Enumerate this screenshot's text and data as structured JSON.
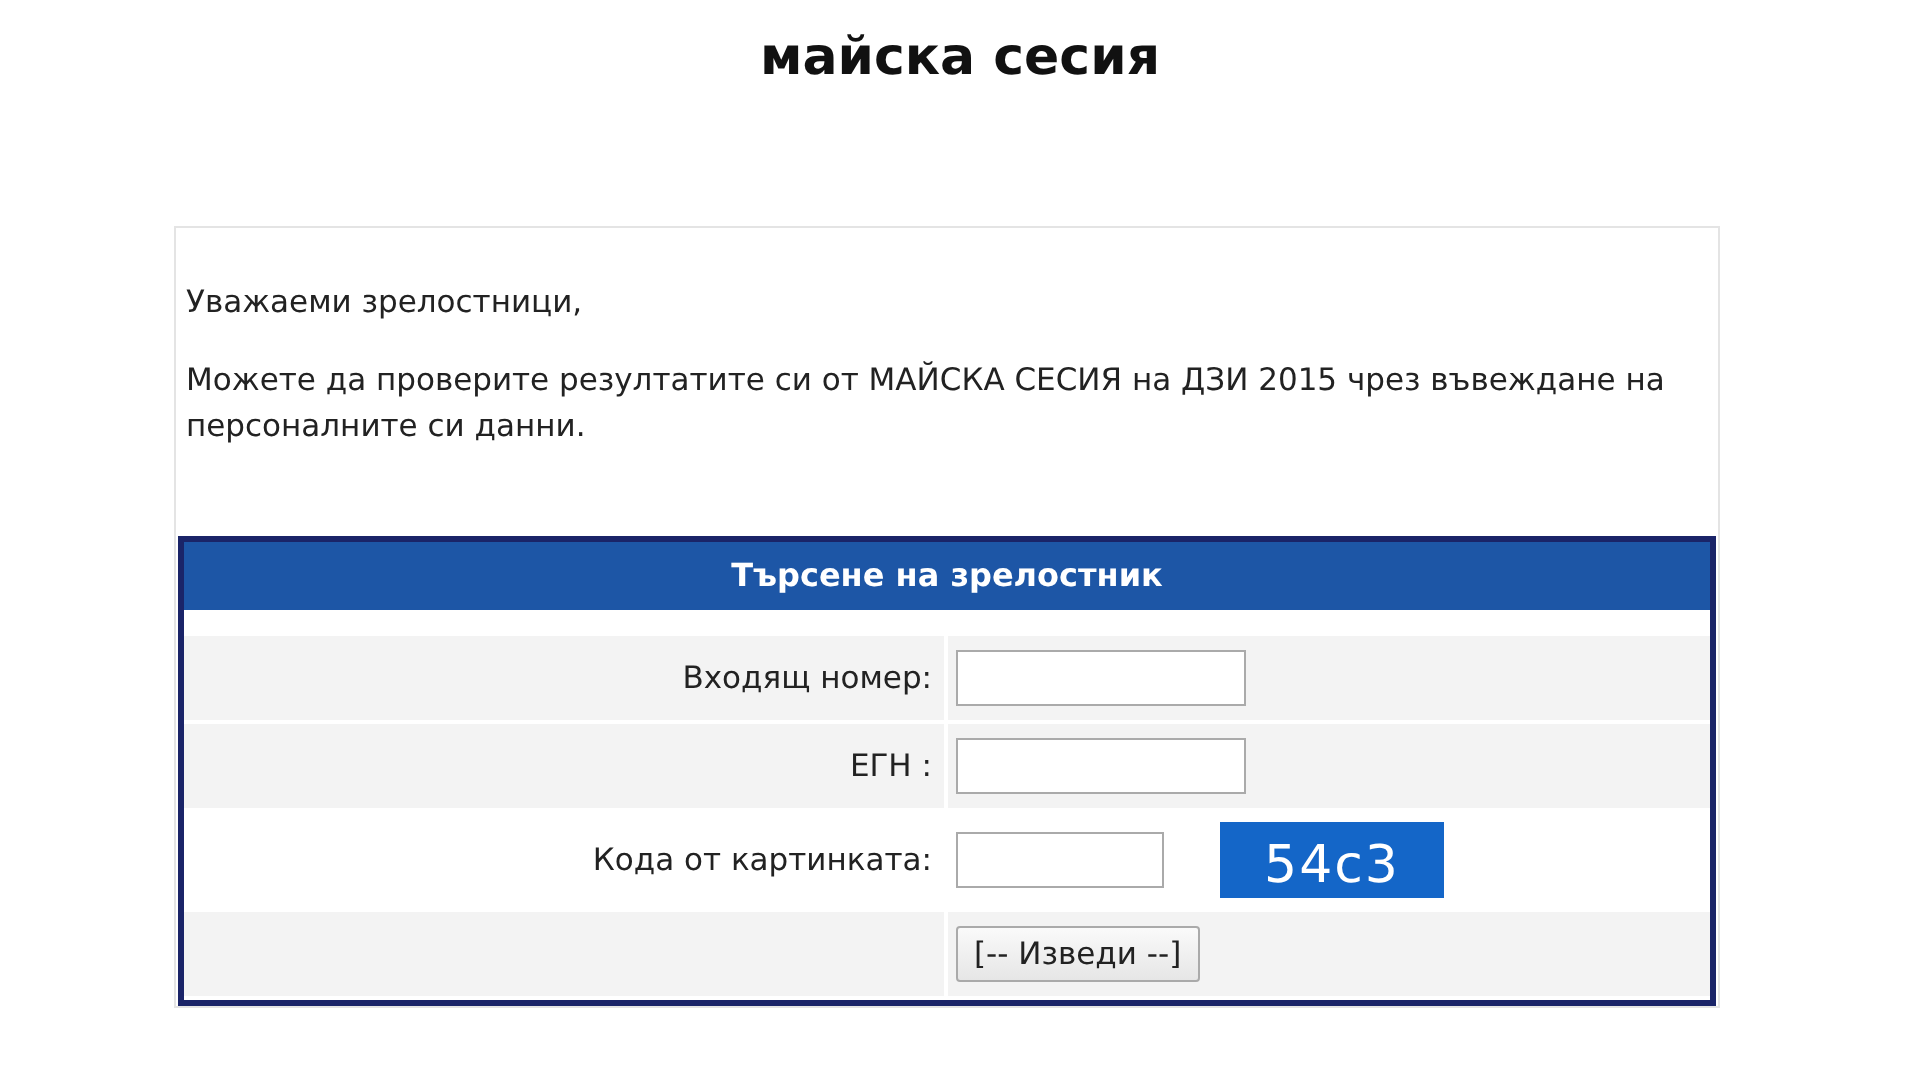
{
  "header": {
    "subtitle": "майска сесия"
  },
  "intro": {
    "greeting": "Уважаеми зрелостници,",
    "message": "Можете да проверите резултатите си от МАЙСКА СЕСИЯ на ДЗИ 2015 чрез въвеждане на персоналните си данни."
  },
  "form": {
    "title": "Търсене на зрелостник",
    "fields": [
      {
        "kind": "text",
        "label": "Входящ номер:"
      },
      {
        "kind": "text",
        "label": "ЕГН :"
      },
      {
        "kind": "captcha",
        "label": "Кода от картинката:",
        "captcha": "54c3"
      }
    ],
    "submit": "[-- Изведи --]"
  }
}
